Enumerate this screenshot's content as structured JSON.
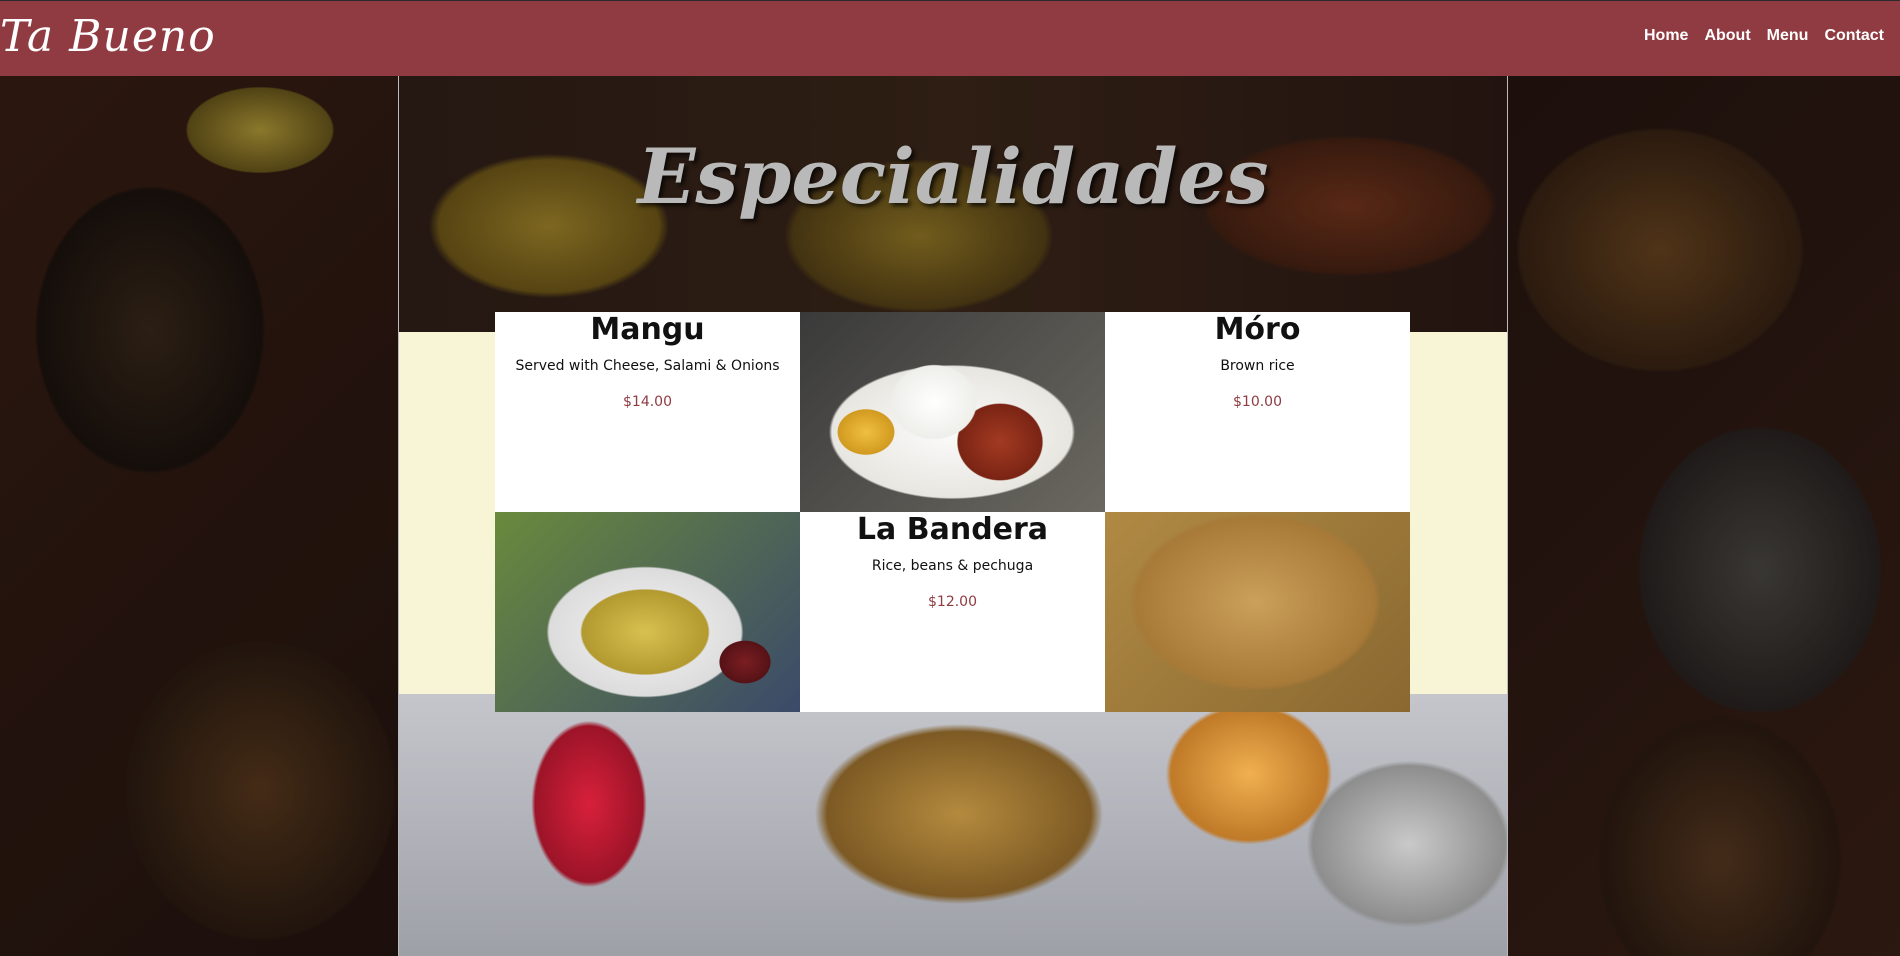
{
  "header": {
    "logo": "Ta Bueno",
    "nav": [
      "Home",
      "About",
      "Menu",
      "Contact"
    ]
  },
  "hero": {
    "title": "Especialidades"
  },
  "menu": [
    {
      "name": "Mangu",
      "description": "Served with Cheese, Salami & Onions",
      "price": "$14.00"
    },
    {
      "name": "Móro",
      "description": "Brown rice",
      "price": "$10.00"
    },
    {
      "name": "La Bandera",
      "description": "Rice, beans & pechuga",
      "price": "$12.00"
    }
  ],
  "colors": {
    "header_bg": "#8f3b41",
    "price": "#8f3b41",
    "cream": "#f7f5d5"
  }
}
